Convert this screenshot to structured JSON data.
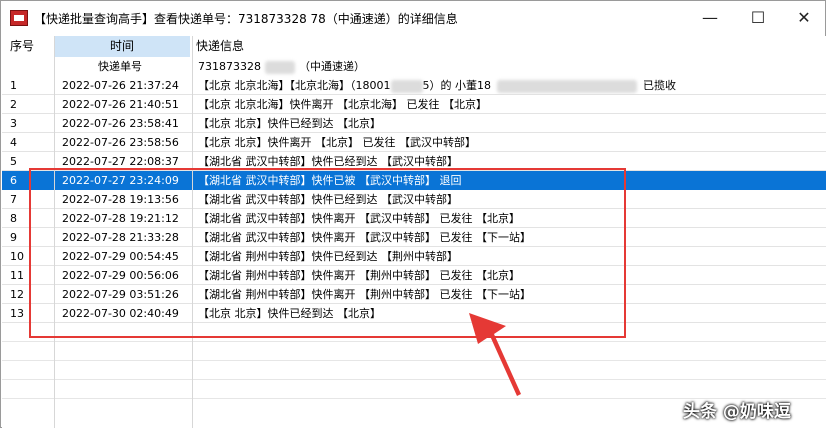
{
  "window": {
    "title": "【快递批量查询高手】查看快递单号：731873328      78（中通速递）的详细信息",
    "min_glyph": "—",
    "max_glyph": "☐",
    "close_glyph": "✕"
  },
  "table": {
    "headers": {
      "no": "序号",
      "time": "时间",
      "info": "快递信息"
    },
    "subheader": {
      "label": "快递单号",
      "value": "731873328",
      "courier": "（中通速递）"
    },
    "rows": [
      {
        "no": "1",
        "time": "2022-07-26 21:37:24",
        "info_a": "【北京 北京北海】【北京北海】（18001",
        "info_b": "5）的 小董18",
        "info_c": "已揽收"
      },
      {
        "no": "2",
        "time": "2022-07-26 21:40:51",
        "info": "【北京 北京北海】快件离开 【北京北海】 已发往 【北京】"
      },
      {
        "no": "3",
        "time": "2022-07-26 23:58:41",
        "info": "【北京 北京】快件已经到达 【北京】"
      },
      {
        "no": "4",
        "time": "2022-07-26 23:58:56",
        "info": "【北京 北京】快件离开 【北京】 已发往 【武汉中转部】"
      },
      {
        "no": "5",
        "time": "2022-07-27 22:08:37",
        "info": "【湖北省 武汉中转部】快件已经到达 【武汉中转部】"
      },
      {
        "no": "6",
        "time": "2022-07-27 23:24:09",
        "info": "【湖北省 武汉中转部】快件已被 【武汉中转部】 退回"
      },
      {
        "no": "7",
        "time": "2022-07-28 19:13:56",
        "info": "【湖北省 武汉中转部】快件已经到达 【武汉中转部】"
      },
      {
        "no": "8",
        "time": "2022-07-28 19:21:12",
        "info": "【湖北省 武汉中转部】快件离开 【武汉中转部】 已发往 【北京】"
      },
      {
        "no": "9",
        "time": "2022-07-28 21:33:28",
        "info": "【湖北省 武汉中转部】快件离开 【武汉中转部】 已发往 【下一站】"
      },
      {
        "no": "10",
        "time": "2022-07-29 00:54:45",
        "info": "【湖北省 荆州中转部】快件已经到达 【荆州中转部】"
      },
      {
        "no": "11",
        "time": "2022-07-29 00:56:06",
        "info": "【湖北省 荆州中转部】快件离开 【荆州中转部】 已发往 【北京】"
      },
      {
        "no": "12",
        "time": "2022-07-29 03:51:26",
        "info": "【湖北省 荆州中转部】快件离开 【荆州中转部】 已发往 【下一站】"
      },
      {
        "no": "13",
        "time": "2022-07-30 02:40:49",
        "info": "【北京 北京】快件已经到达 【北京】"
      }
    ]
  },
  "annotation": {
    "color": "#e53935"
  },
  "watermark": "头条 @奶味逗",
  "colors": {
    "selected_row": "#0a74d6",
    "time_header": "#cfe4f7"
  }
}
